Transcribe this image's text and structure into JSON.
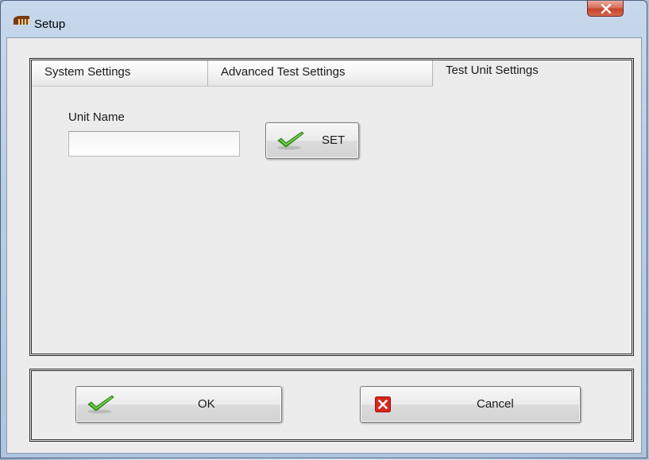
{
  "window": {
    "title": "Setup",
    "app_icon": "piano-icon",
    "close_icon": "close-icon"
  },
  "tabs": [
    {
      "label": "System Settings",
      "active": false
    },
    {
      "label": "Advanced Test Settings",
      "active": false
    },
    {
      "label": "Test Unit Settings",
      "active": true
    }
  ],
  "test_unit_settings": {
    "unit_name_label": "Unit Name",
    "unit_name_value": "",
    "set_button_label": "SET",
    "set_button_icon": "checkmark-icon"
  },
  "footer": {
    "ok_label": "OK",
    "ok_icon": "checkmark-icon",
    "cancel_label": "Cancel",
    "cancel_icon": "red-x-icon"
  },
  "colors": {
    "title_bar": "#b9cde6",
    "close_button": "#c4432b",
    "client_background": "#ececec",
    "checkmark_green": "#3aa51a",
    "cancel_red": "#d8261c"
  }
}
